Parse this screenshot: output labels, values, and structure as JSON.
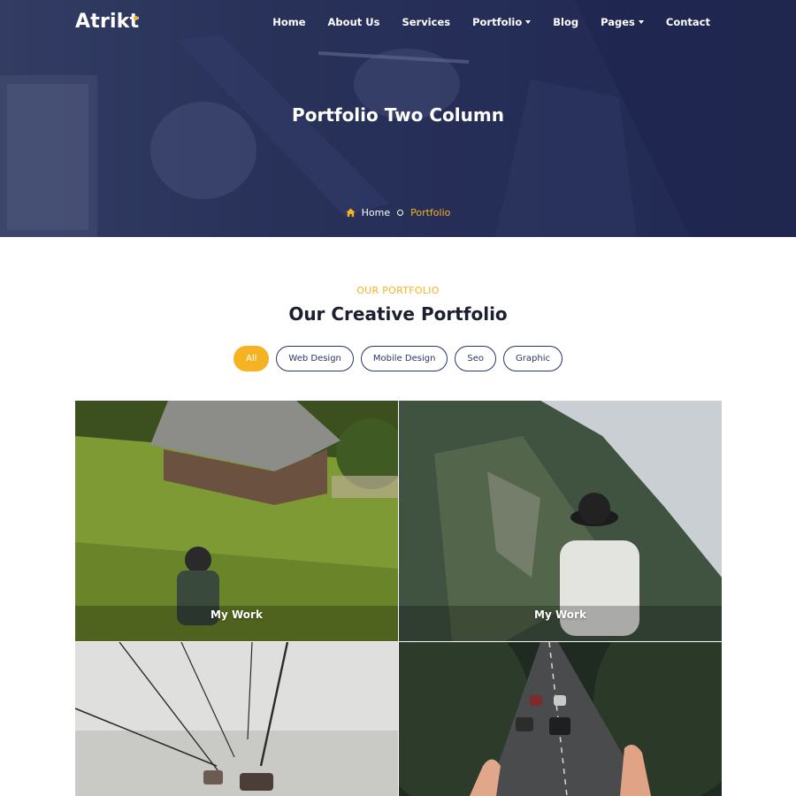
{
  "brand": {
    "name": "Atrikt",
    "accent": "#f5b324",
    "navy": "#2b3565"
  },
  "nav": {
    "items": [
      {
        "label": "Home",
        "dropdown": false
      },
      {
        "label": "About Us",
        "dropdown": false
      },
      {
        "label": "Services",
        "dropdown": false
      },
      {
        "label": "Portfolio",
        "dropdown": true
      },
      {
        "label": "Blog",
        "dropdown": false
      },
      {
        "label": "Pages",
        "dropdown": true
      },
      {
        "label": "Contact",
        "dropdown": false
      }
    ]
  },
  "hero": {
    "title": "Portfolio Two Column",
    "breadcrumb": {
      "home": "Home",
      "current": "Portfolio",
      "home_icon": "home-icon"
    }
  },
  "portfolio": {
    "kicker": "OUR PORTFOLIO",
    "title": "Our Creative Portfolio",
    "filters": [
      {
        "label": "All",
        "active": true
      },
      {
        "label": "Web Design",
        "active": false
      },
      {
        "label": "Mobile Design",
        "active": false
      },
      {
        "label": "Seo",
        "active": false
      },
      {
        "label": "Graphic",
        "active": false
      }
    ],
    "items": [
      {
        "label": "My Work",
        "image": "cabin-meadow-photo"
      },
      {
        "label": "My Work",
        "image": "mountain-hat-photo"
      },
      {
        "label": "",
        "image": "cable-car-fog-photo"
      },
      {
        "label": "",
        "image": "forest-road-photo"
      }
    ]
  }
}
